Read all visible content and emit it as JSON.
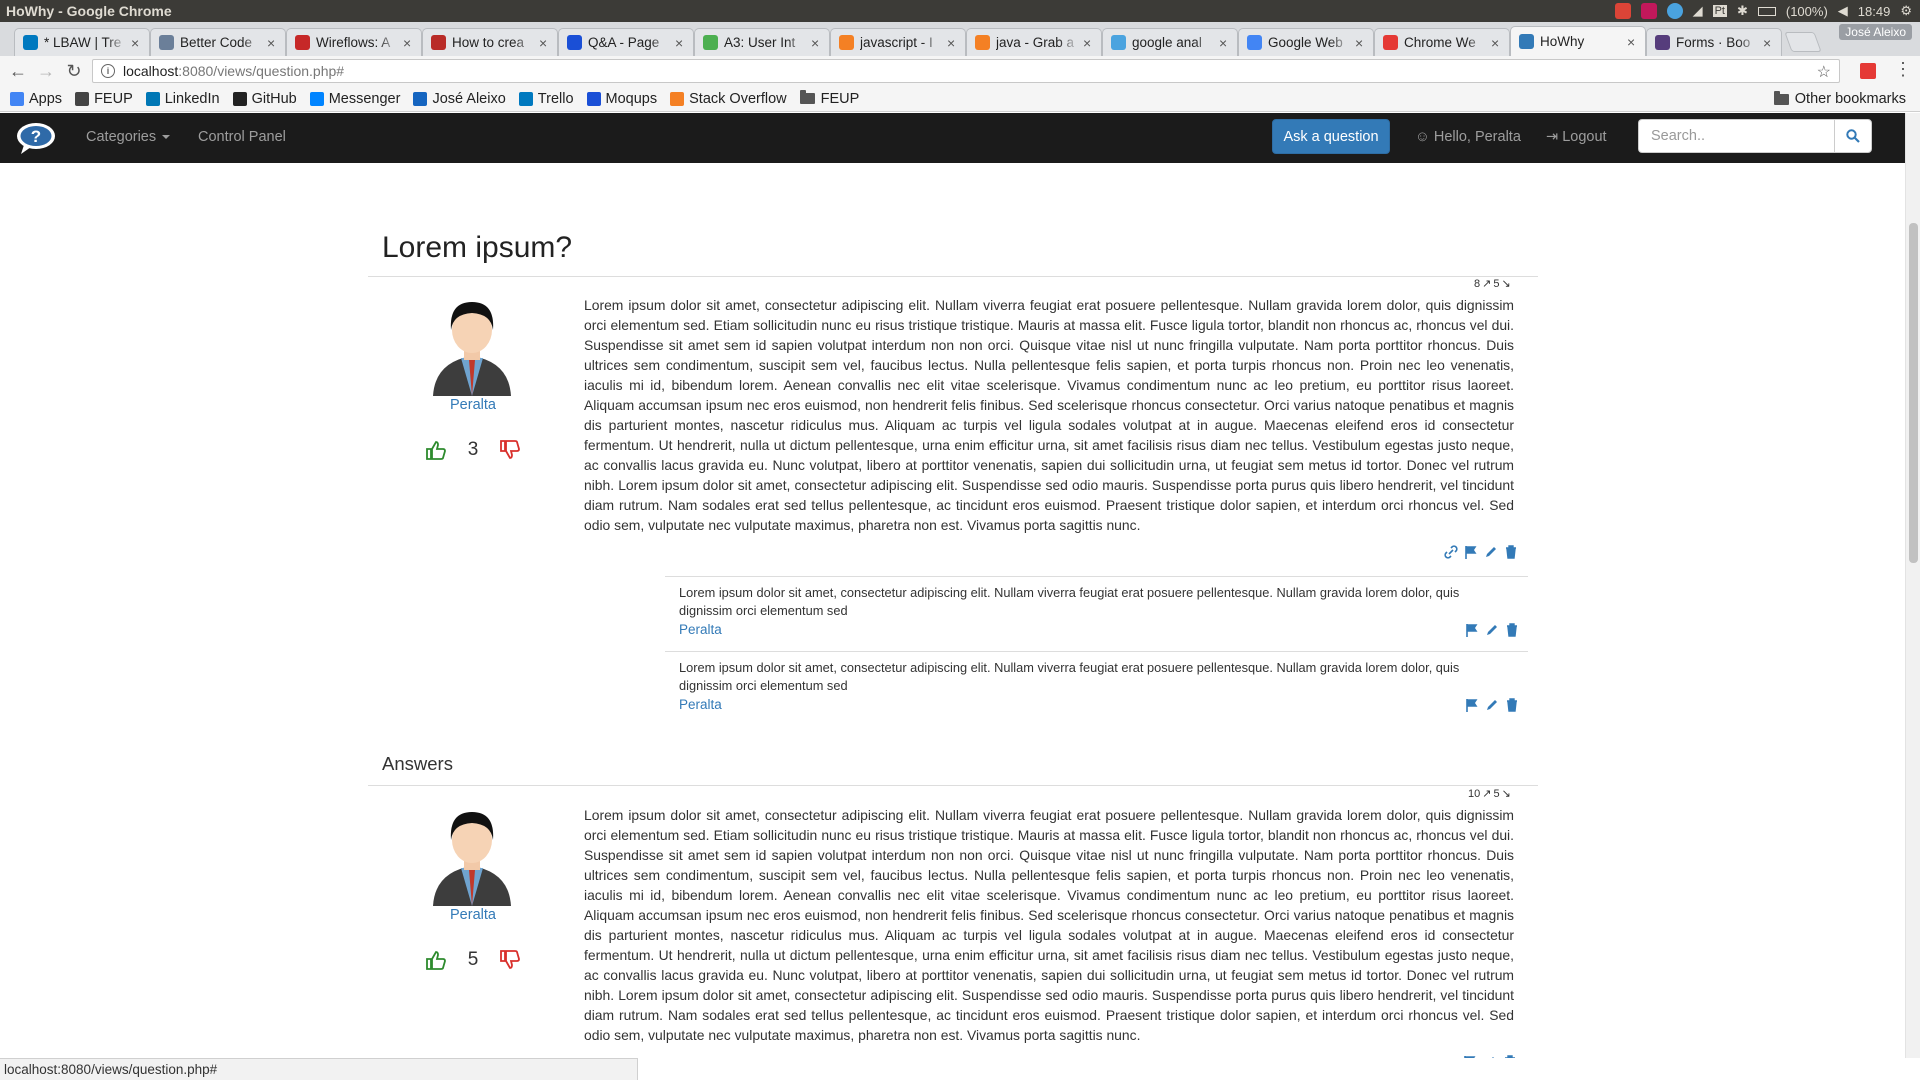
{
  "os_bar": {
    "window_title": "HoWhy - Google Chrome",
    "battery": "(100%)",
    "time": "18:49",
    "keyboard_layout": "Pt"
  },
  "tabs": [
    {
      "title": "* LBAW | Tre",
      "favicon": "trello-icon",
      "color": "#0079bf",
      "active": false
    },
    {
      "title": "Better Code",
      "favicon": "clock-icon",
      "color": "#6b7f99",
      "active": false
    },
    {
      "title": "Wireflows: A",
      "favicon": "nn-icon",
      "color": "#c62828",
      "active": false
    },
    {
      "title": "How to crea",
      "favicon": "quora-icon",
      "color": "#b92b27",
      "active": false
    },
    {
      "title": "Q&A - Page",
      "favicon": "moqups-icon",
      "color": "#1a4fd6",
      "active": false
    },
    {
      "title": "A3: User Int",
      "favicon": "git-icon",
      "color": "#4caf50",
      "active": false
    },
    {
      "title": "javascript - I",
      "favicon": "stackoverflow-icon",
      "color": "#f48024",
      "active": false
    },
    {
      "title": "java - Grab a",
      "favicon": "stackoverflow-icon",
      "color": "#f48024",
      "active": false
    },
    {
      "title": "google anal",
      "favicon": "analytics-icon",
      "color": "#4aa3df",
      "active": false
    },
    {
      "title": "Google Web",
      "favicon": "google-icon",
      "color": "#4285f4",
      "active": false
    },
    {
      "title": "Chrome We",
      "favicon": "chrome-icon",
      "color": "#e53935",
      "active": false
    },
    {
      "title": "HoWhy",
      "favicon": "howhy-icon",
      "color": "#337ab7",
      "active": true
    },
    {
      "title": "Forms · Boo",
      "favicon": "bootstrap-icon",
      "color": "#563d7c",
      "active": false
    }
  ],
  "profile_name": "José Aleixo",
  "address_bar": {
    "host": "localhost",
    "path": ":8080/views/question.php#"
  },
  "bookmarks": [
    {
      "label": "Apps",
      "icon": "apps-grid-icon",
      "color": "#4285f4"
    },
    {
      "label": "FEUP",
      "icon": "feup-icon",
      "color": "#444"
    },
    {
      "label": "LinkedIn",
      "icon": "linkedin-icon",
      "color": "#0077b5"
    },
    {
      "label": "GitHub",
      "icon": "github-icon",
      "color": "#222"
    },
    {
      "label": "Messenger",
      "icon": "messenger-icon",
      "color": "#0084ff"
    },
    {
      "label": "José Aleixo",
      "icon": "letter-j-icon",
      "color": "#1565c0"
    },
    {
      "label": "Trello",
      "icon": "trello-icon",
      "color": "#0079bf"
    },
    {
      "label": "Moqups",
      "icon": "moqups-icon",
      "color": "#1a4fd6"
    },
    {
      "label": "Stack Overflow",
      "icon": "stackoverflow-icon",
      "color": "#f48024"
    },
    {
      "label": "FEUP",
      "icon": "folder-icon",
      "color": "#555"
    }
  ],
  "other_bookmarks": "Other bookmarks",
  "site_nav": {
    "categories": "Categories",
    "control_panel": "Control Panel",
    "ask": "Ask a question",
    "greeting": "Hello, Peralta",
    "logout": "Logout",
    "search_placeholder": "Search.."
  },
  "question": {
    "title": "Lorem ipsum?",
    "likes": "8",
    "dislikes": "5",
    "author": "Peralta",
    "score": "3",
    "body": "Lorem ipsum dolor sit amet, consectetur adipiscing elit. Nullam viverra feugiat erat posuere pellentesque. Nullam gravida lorem dolor, quis dignissim orci elementum sed. Etiam sollicitudin nunc eu risus tristique tristique. Mauris at massa elit. Fusce ligula tortor, blandit non rhoncus ac, rhoncus vel dui. Suspendisse sit amet sem id sapien volutpat interdum non non orci. Quisque vitae nisl ut nunc fringilla vulputate. Nam porta porttitor rhoncus. Duis ultrices sem condimentum, suscipit sem vel, faucibus lectus. Nulla pellentesque felis sapien, et porta turpis rhoncus non. Proin nec leo venenatis, iaculis mi id, bibendum lorem. Aenean convallis nec elit vitae scelerisque. Vivamus condimentum nunc ac leo pretium, eu porttitor risus laoreet. Aliquam accumsan ipsum nec eros euismod, non hendrerit felis finibus. Sed scelerisque rhoncus consectetur. Orci varius natoque penatibus et magnis dis parturient montes, nascetur ridiculus mus. Aliquam ac turpis vel ligula sodales volutpat at in augue. Maecenas eleifend eros id consectetur fermentum. Ut hendrerit, nulla ut dictum pellentesque, urna enim efficitur urna, sit amet facilisis risus diam nec tellus. Vestibulum egestas justo neque, ac convallis lacus gravida eu. Nunc volutpat, libero at porttitor venenatis, sapien dui sollicitudin urna, ut feugiat sem metus id tortor. Donec vel rutrum nibh. Lorem ipsum dolor sit amet, consectetur adipiscing elit. Suspendisse sed odio mauris. Suspendisse porta purus quis libero hendrerit, vel tincidunt diam rutrum. Nam sodales erat sed tellus pellentesque, ac tincidunt eros euismod. Praesent tristique dolor sapien, et interdum orci rhoncus vel. Sed odio sem, vulputate nec vulputate maximus, pharetra non est. Vivamus porta sagittis nunc."
  },
  "comments": [
    {
      "text": "Lorem ipsum dolor sit amet, consectetur adipiscing elit. Nullam viverra feugiat erat posuere pellentesque. Nullam gravida lorem dolor, quis dignissim orci elementum sed",
      "author": "Peralta"
    },
    {
      "text": "Lorem ipsum dolor sit amet, consectetur adipiscing elit. Nullam viverra feugiat erat posuere pellentesque. Nullam gravida lorem dolor, quis dignissim orci elementum sed",
      "author": "Peralta"
    }
  ],
  "answers_heading": "Answers",
  "answer": {
    "likes": "10",
    "dislikes": "5",
    "author": "Peralta",
    "score": "5",
    "body": "Lorem ipsum dolor sit amet, consectetur adipiscing elit. Nullam viverra feugiat erat posuere pellentesque. Nullam gravida lorem dolor, quis dignissim orci elementum sed. Etiam sollicitudin nunc eu risus tristique tristique. Mauris at massa elit. Fusce ligula tortor, blandit non rhoncus ac, rhoncus vel dui. Suspendisse sit amet sem id sapien volutpat interdum non non orci. Quisque vitae nisl ut nunc fringilla vulputate. Nam porta porttitor rhoncus. Duis ultrices sem condimentum, suscipit sem vel, faucibus lectus. Nulla pellentesque felis sapien, et porta turpis rhoncus non. Proin nec leo venenatis, iaculis mi id, bibendum lorem. Aenean convallis nec elit vitae scelerisque. Vivamus condimentum nunc ac leo pretium, eu porttitor risus laoreet. Aliquam accumsan ipsum nec eros euismod, non hendrerit felis finibus. Sed scelerisque rhoncus consectetur. Orci varius natoque penatibus et magnis dis parturient montes, nascetur ridiculus mus. Aliquam ac turpis vel ligula sodales volutpat at in augue. Maecenas eleifend eros id consectetur fermentum. Ut hendrerit, nulla ut dictum pellentesque, urna enim efficitur urna, sit amet facilisis risus diam nec tellus. Vestibulum egestas justo neque, ac convallis lacus gravida eu. Nunc volutpat, libero at porttitor venenatis, sapien dui sollicitudin urna, ut feugiat sem metus id tortor. Donec vel rutrum nibh. Lorem ipsum dolor sit amet, consectetur adipiscing elit. Suspendisse sed odio mauris. Suspendisse porta purus quis libero hendrerit, vel tincidunt diam rutrum. Nam sodales erat sed tellus pellentesque, ac tincidunt eros euismod. Praesent tristique dolor sapien, et interdum orci rhoncus vel. Sed odio sem, vulputate nec vulputate maximus, pharetra non est. Vivamus porta sagittis nunc."
  },
  "status_url": "localhost:8080/views/question.php#",
  "colors": {
    "link": "#337ab7",
    "upvote": "#2e8b2e",
    "downvote": "#d9302c",
    "navbar": "#1b1b1b",
    "primary_button": "#337ab7"
  }
}
